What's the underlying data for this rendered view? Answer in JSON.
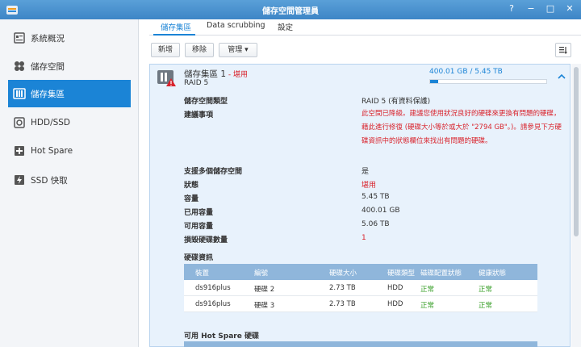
{
  "window": {
    "title": "儲存空間管理員",
    "controls": [
      "?",
      "−",
      "□",
      "✕"
    ]
  },
  "sidebar": {
    "items": [
      {
        "label": "系統概況",
        "icon": "overview-icon"
      },
      {
        "label": "儲存空間",
        "icon": "volume-icon"
      },
      {
        "label": "儲存集區",
        "icon": "storage-pool-icon",
        "active": true
      },
      {
        "label": "HDD/SSD",
        "icon": "hdd-icon"
      },
      {
        "label": "Hot Spare",
        "icon": "hot-spare-icon"
      },
      {
        "label": "SSD 快取",
        "icon": "ssd-cache-icon"
      }
    ]
  },
  "tabs": [
    {
      "label": "儲存集區",
      "active": true
    },
    {
      "label": "Data scrubbing"
    },
    {
      "label": "設定"
    }
  ],
  "toolbar": {
    "create": "新增",
    "remove": "移除",
    "manage": "管理 ▾"
  },
  "pool": {
    "name": "儲存集區 1",
    "status_prefix": " - ",
    "status": "堪用",
    "raid": "RAID 5",
    "capacity_text": "400.01 GB / 5.45 TB",
    "used_fraction": 0.07,
    "fields": [
      {
        "label": "儲存空間類型",
        "value": "RAID 5 (有資料保護)"
      },
      {
        "label": "建議事項",
        "value": ""
      },
      {
        "label": "支援多個儲存空間",
        "value": "是"
      },
      {
        "label": "狀態",
        "value": "堪用",
        "red": true
      },
      {
        "label": "容量",
        "value": "5.45 TB"
      },
      {
        "label": "已用容量",
        "value": "400.01 GB"
      },
      {
        "label": "可用容量",
        "value": "5.06 TB"
      },
      {
        "label": "損毀硬碟數量",
        "value": "1",
        "red": true
      }
    ],
    "warning": "此空間已降級。建議您使用狀況良好的硬碟來更換有問題的硬碟，藉此進行修復 (硬碟大小等於或大於 \"2794 GB\"。)。請參見下方硬碟資訊中的狀態欄位來找出有問題的硬碟。"
  },
  "disk_info": {
    "title": "硬碟資訊",
    "columns": [
      "裝置",
      "編號",
      "硬碟大小",
      "硬碟類型",
      "磁碟配置狀態",
      "健康狀態"
    ],
    "rows": [
      [
        "ds916plus",
        "硬碟 2",
        "2.73 TB",
        "HDD",
        "正常",
        "正常"
      ],
      [
        "ds916plus",
        "硬碟 3",
        "2.73 TB",
        "HDD",
        "正常",
        "正常"
      ]
    ]
  },
  "hot_spare_section": "可用 Hot Spare 硬碟",
  "colors": {
    "accent": "#1b84d6",
    "danger": "#d9232c",
    "ok": "#3aa02a",
    "table_header": "#8fb6db",
    "panel_bg": "#e8f2fc"
  }
}
